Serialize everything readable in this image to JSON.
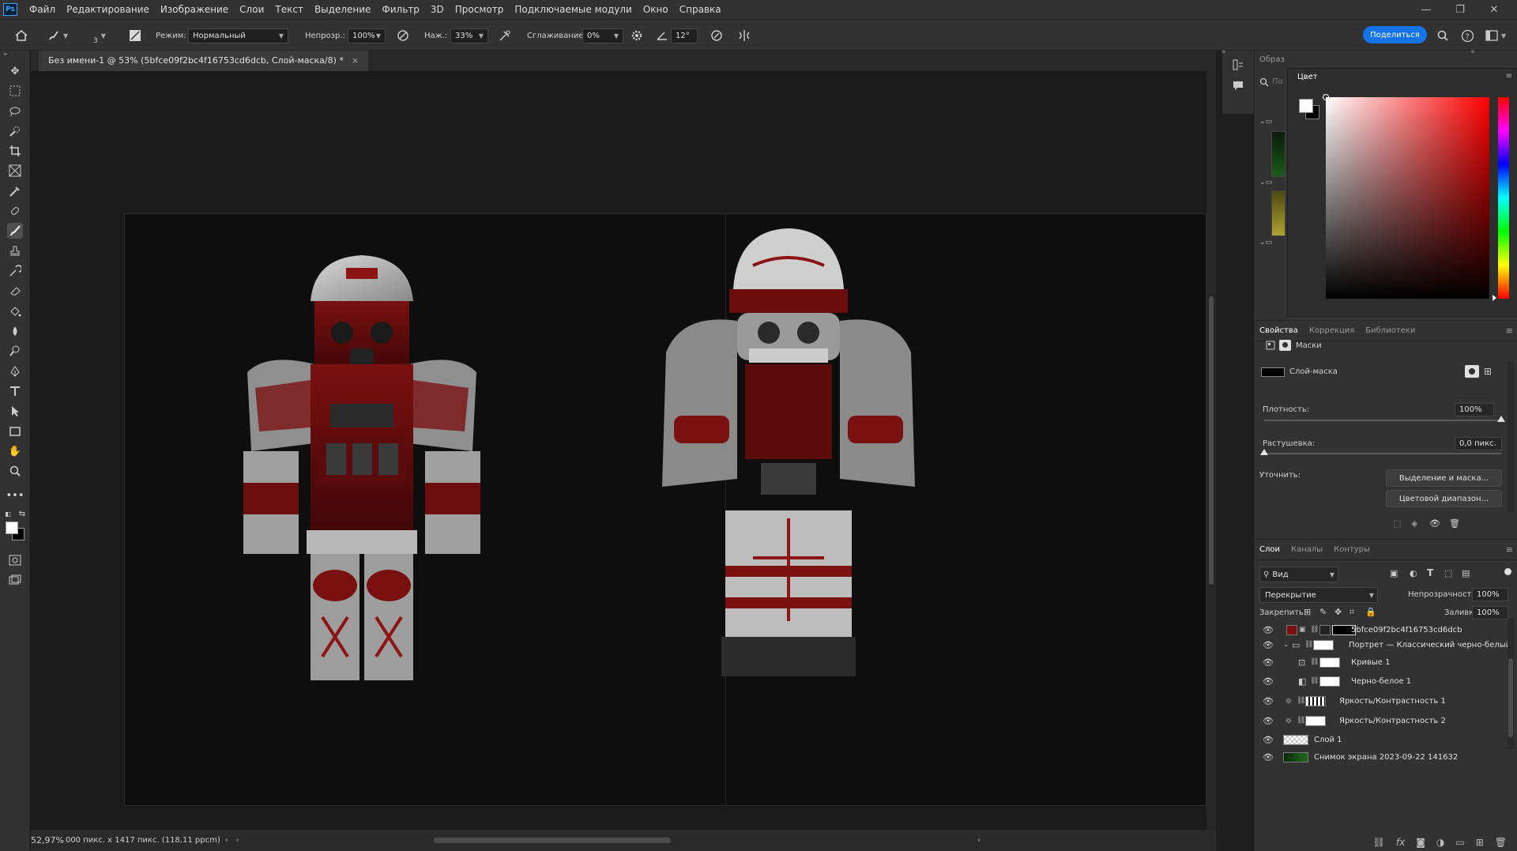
{
  "menubar": {
    "logo": "Ps",
    "items": [
      "Файл",
      "Редактирование",
      "Изображение",
      "Слои",
      "Текст",
      "Выделение",
      "Фильтр",
      "3D",
      "Просмотр",
      "Подключаемые модули",
      "Окно",
      "Справка"
    ]
  },
  "options": {
    "brush_size": "3",
    "mode_label": "Режим:",
    "mode_value": "Нормальный",
    "opacity_label": "Непрозр.:",
    "opacity_value": "100%",
    "flow_label": "Наж.:",
    "flow_value": "33%",
    "smoothing_label": "Сглаживание:",
    "smoothing_value": "0%",
    "angle_value": "12°",
    "share_label": "Поделиться"
  },
  "document": {
    "tab_title": "Без имени-1 @ 53% (5bfce09f2bc4f16753cd6dcb, Слой-маска/8) *",
    "zoom": "52,97%",
    "doc_info": "000 пикс. x 1417 пикс. (118,11 ppcm)"
  },
  "color_panel": {
    "collapsed_tab": "Образ",
    "title": "Цвет",
    "search_placeholder": "По"
  },
  "properties": {
    "tabs": [
      "Свойства",
      "Коррекция",
      "Библиотеки"
    ],
    "masks_label": "Маски",
    "layer_mask_label": "Слой-маска",
    "density_label": "Плотность:",
    "density_value": "100%",
    "density_level": 1.0,
    "feather_label": "Растушевка:",
    "feather_value": "0,0 пикс.",
    "feather_level": 0.0,
    "refine_label": "Уточнить:",
    "select_mask_btn": "Выделение и маска...",
    "color_range_btn": "Цветовой диапазон..."
  },
  "layers": {
    "tabs": [
      "Слои",
      "Каналы",
      "Контуры"
    ],
    "filter_label": "Вид",
    "blend_mode": "Перекрытие",
    "opacity_label": "Непрозрачность:",
    "opacity_value": "100%",
    "lock_label": "Закрепить:",
    "fill_label": "Заливка:",
    "fill_value": "100%",
    "items": [
      {
        "name": "5bfce09f2bc4f16753cd6dcb"
      },
      {
        "name": "Портрет — Классический черно-белый"
      },
      {
        "name": "Кривые 1"
      },
      {
        "name": "Черно-белое 1"
      },
      {
        "name": "Яркость/Контрастность 1"
      },
      {
        "name": "Яркость/Контрастность 2"
      },
      {
        "name": "Слой 1"
      },
      {
        "name": "Снимок экрана 2023-09-22 141632"
      }
    ]
  },
  "colors": {
    "accent": "#1473e6",
    "app_bg": "#323232",
    "canvas_bg": "#0e0e0e"
  }
}
